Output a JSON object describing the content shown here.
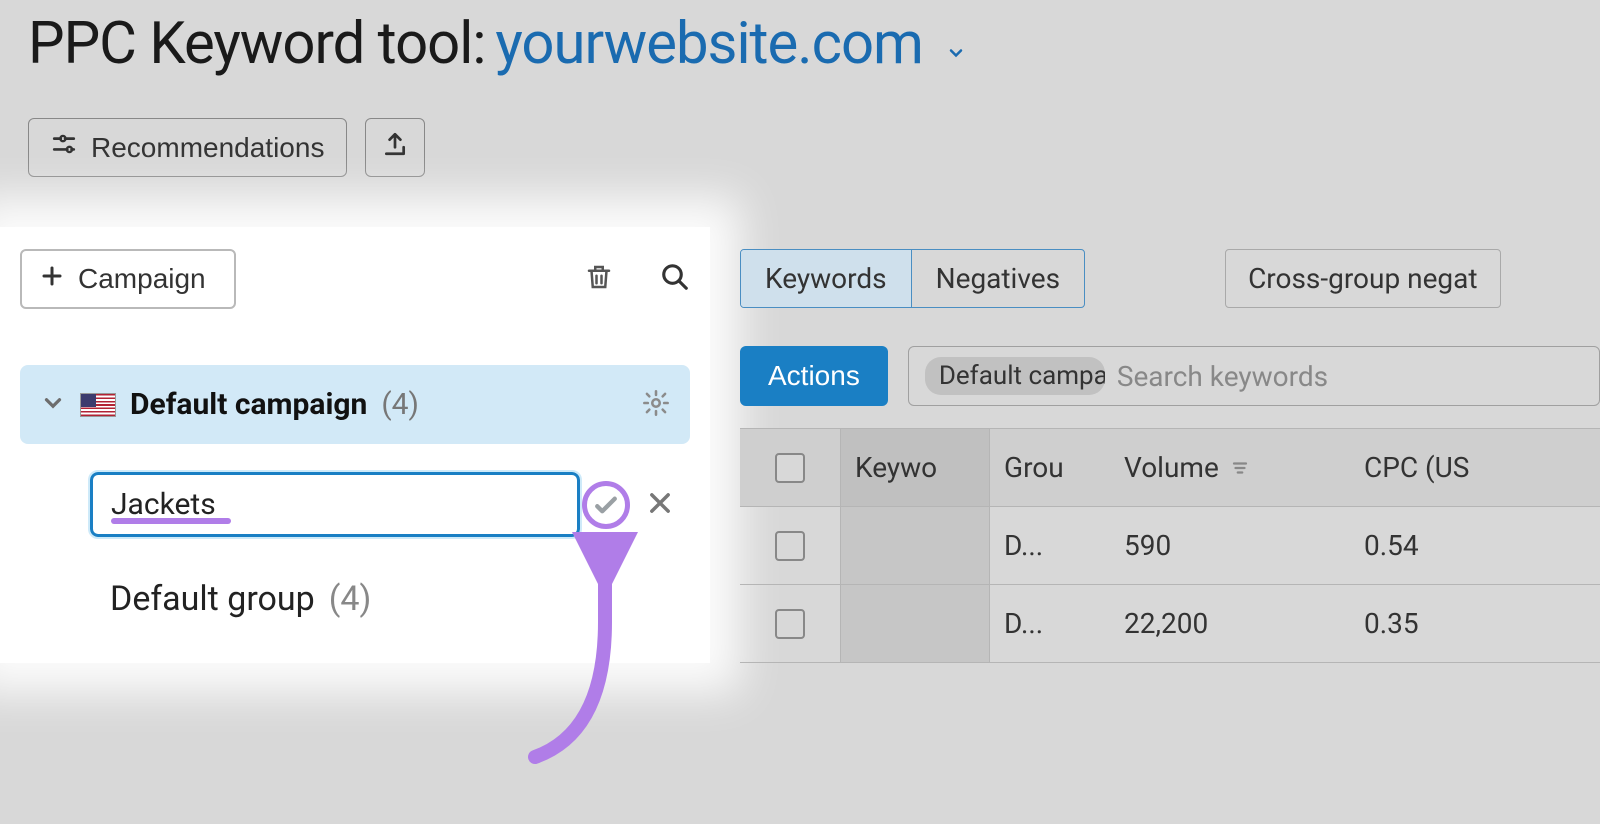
{
  "header": {
    "title_prefix": "PPC Keyword tool:",
    "domain": "yourwebsite.com"
  },
  "toolbar": {
    "recommendations_label": "Recommendations"
  },
  "sidebar": {
    "add_campaign_label": "Campaign",
    "campaign": {
      "name": "Default campaign",
      "count": "(4)"
    },
    "new_group_input_value": "Jackets",
    "default_group": {
      "name": "Default group",
      "count": "(4)"
    }
  },
  "right": {
    "tabs": {
      "keywords": "Keywords",
      "negatives": "Negatives"
    },
    "cross_group_label": "Cross-group negat",
    "actions_label": "Actions",
    "chip_label": "Default campa",
    "search_placeholder": "Search keywords",
    "columns": {
      "keyword": "Keywo",
      "group": "Grou",
      "volume": "Volume",
      "cpc": "CPC (US"
    },
    "rows": [
      {
        "group": "D...",
        "volume": "590",
        "cpc": "0.54"
      },
      {
        "group": "D...",
        "volume": "22,200",
        "cpc": "0.35"
      }
    ]
  }
}
